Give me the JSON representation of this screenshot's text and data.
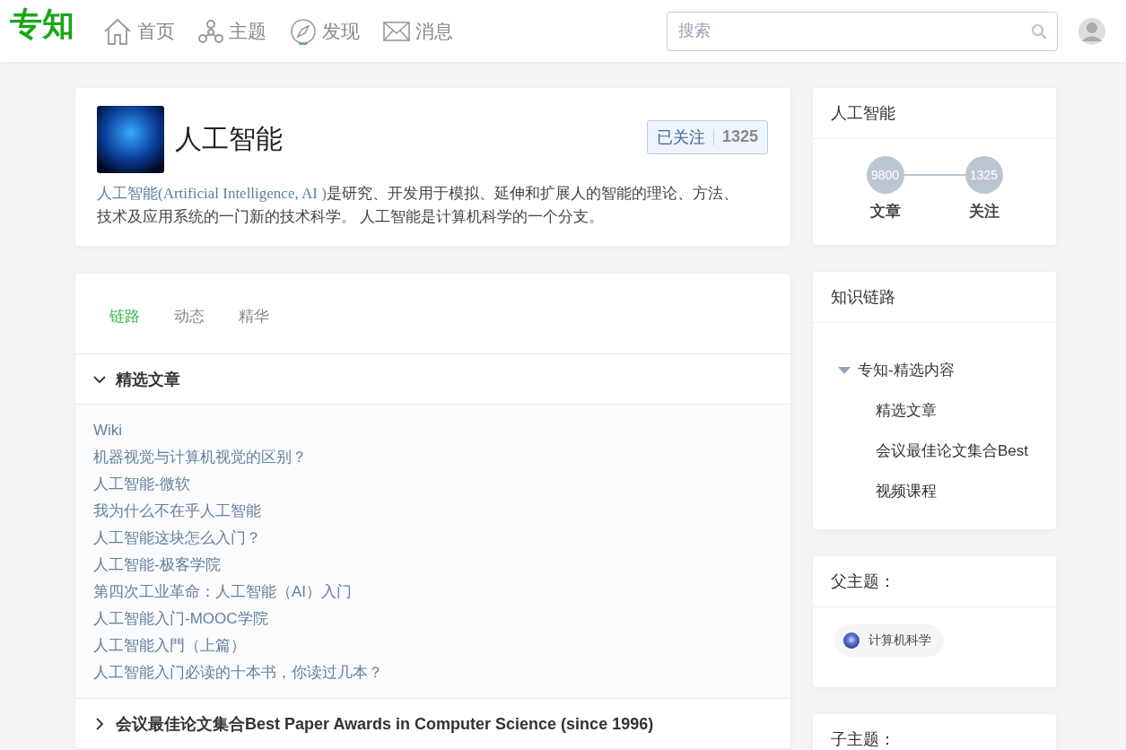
{
  "header": {
    "logo": "专知",
    "nav": [
      {
        "label": "首页"
      },
      {
        "label": "主题"
      },
      {
        "label": "发现"
      },
      {
        "label": "消息"
      }
    ],
    "search": {
      "placeholder": "搜索"
    }
  },
  "topic": {
    "title": "人工智能",
    "follow": {
      "label": "已关注",
      "count": "1325"
    },
    "description": {
      "link": "人工智能(Artificial Intelligence, AI )",
      "text": "是研究、开发用于模拟、延伸和扩展人的智能的理论、方法、技术及应用系统的一门新的技术科学。 人工智能是计算机科学的一个分支。"
    }
  },
  "tabs": [
    {
      "label": "链路",
      "selected": true
    },
    {
      "label": "动态",
      "selected": false
    },
    {
      "label": "精华",
      "selected": false
    }
  ],
  "sections": [
    {
      "title": "精选文章",
      "expanded": true,
      "items": [
        "Wiki",
        "机器视觉与计算机视觉的区别？",
        "人工智能-微软",
        "我为什么不在乎人工智能",
        "人工智能这块怎么入门？",
        "人工智能-极客学院",
        "第四次工业革命：人工智能（AI）入门",
        "人工智能入门-MOOC学院",
        "人工智能入門（上篇）",
        "人工智能入门必读的十本书，你读过几本？"
      ]
    },
    {
      "title": "会议最佳论文集合Best Paper Awards in Computer Science (since 1996)",
      "expanded": false
    }
  ],
  "sidebar": {
    "stats_card": {
      "title": "人工智能",
      "stats": [
        {
          "value": "9800",
          "label": "文章"
        },
        {
          "value": "1325",
          "label": "关注"
        }
      ]
    },
    "knowledge_chain": {
      "title": "知识链路",
      "tree": [
        {
          "label": "专知-精选内容",
          "expanded": true,
          "children": [
            {
              "label": "精选文章"
            },
            {
              "label": "会议最佳论文集合Best"
            },
            {
              "label": "视频课程"
            }
          ]
        }
      ]
    },
    "parent_topics": {
      "title": "父主题：",
      "items": [
        "计算机科学"
      ]
    },
    "child_topics": {
      "title": "子主题："
    }
  }
}
